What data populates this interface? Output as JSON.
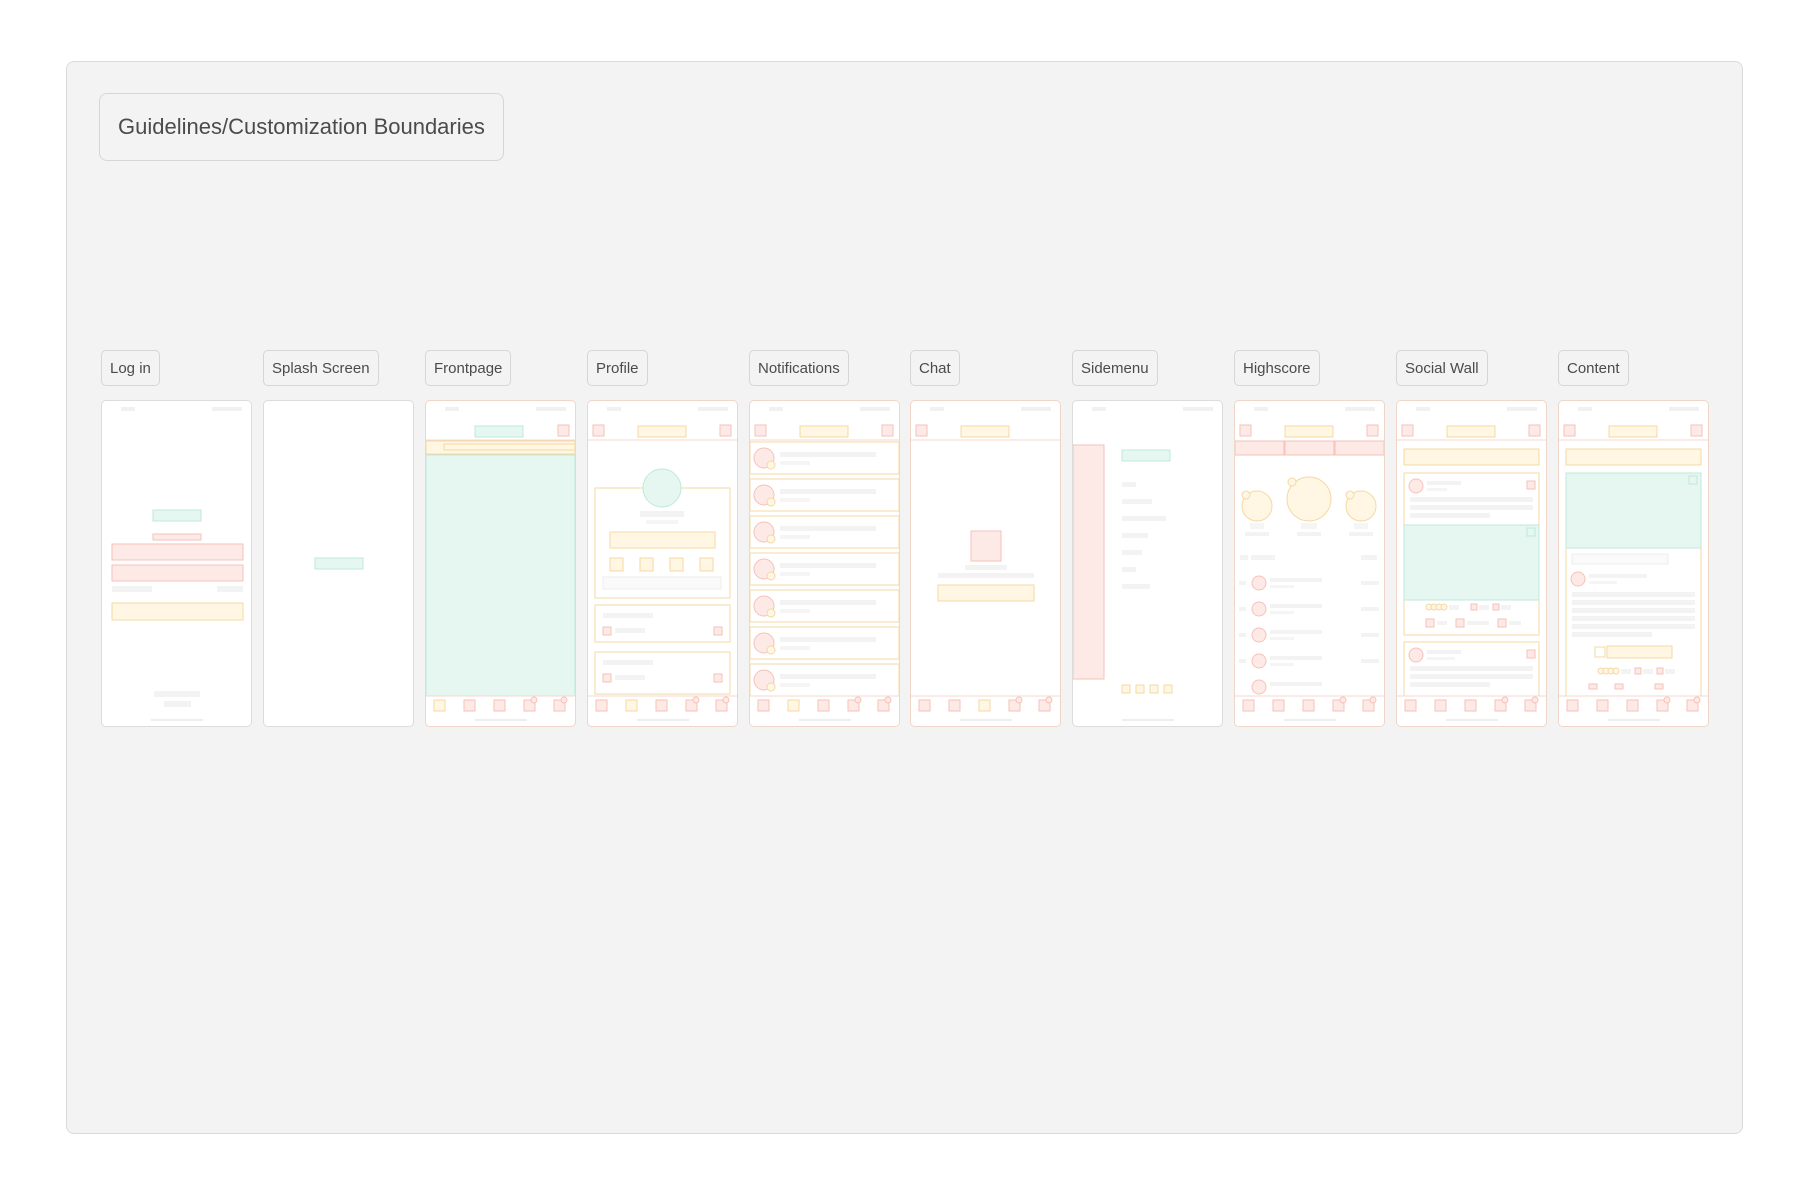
{
  "board": {
    "title": "Guidelines/Customization Boundaries"
  },
  "screens": [
    {
      "label": "Log in"
    },
    {
      "label": "Splash Screen"
    },
    {
      "label": "Frontpage"
    },
    {
      "label": "Profile"
    },
    {
      "label": "Notifications"
    },
    {
      "label": "Chat"
    },
    {
      "label": "Sidemenu"
    },
    {
      "label": "Highscore"
    },
    {
      "label": "Social Wall"
    },
    {
      "label": "Content"
    }
  ],
  "colors": {
    "board_bg": "#f3f3f3",
    "phone_bg": "#ffffff",
    "mint": "#e6f7f1",
    "mint_stroke": "#bfe8da",
    "salmon": "#fde9e6",
    "salmon_stroke": "#f6c2b9",
    "cream": "#fff6e3",
    "cream_stroke": "#f4d9a3",
    "gray_line": "#eeeeee"
  }
}
